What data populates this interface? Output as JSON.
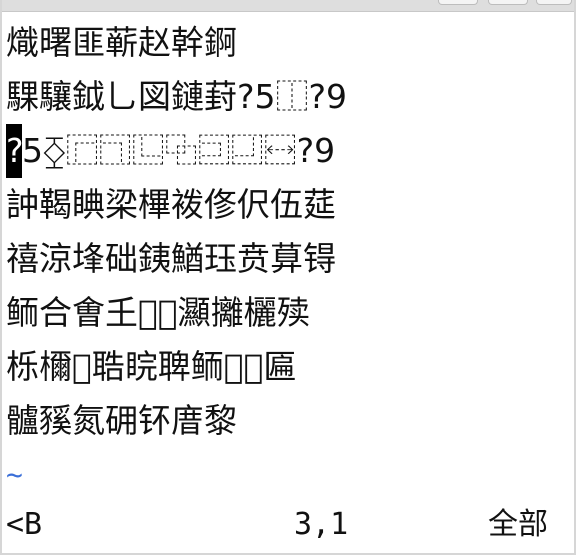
{
  "editor": {
    "lines": [
      "熾曙匪蕲赵幹錒",
      "騍驤鉞⺃図鏈葑?5⿰?9",
      "?5㇁⿸⿹⿺⿻⿼⿽⿾⿿?9",
      "訲鞨睓梁㮿袯俢伬伍莚",
      "禧涼埄础銕鰌珏贲萛锝",
      "鲕合㑹𡈼𫃲𫉄灦攡欐㱩",
      "栎檷𧆛聕睆聛鲕𪪴𨻻匾",
      "髗豯氮砽钚庴黎"
    ],
    "cursor_char": "?",
    "cursor_rest": "5⧰⿸⿹⿺⿻⿼⿽⿾?9",
    "tilde": "~"
  },
  "status": {
    "mode": "<B",
    "position": "3,1",
    "scroll": "全部"
  }
}
